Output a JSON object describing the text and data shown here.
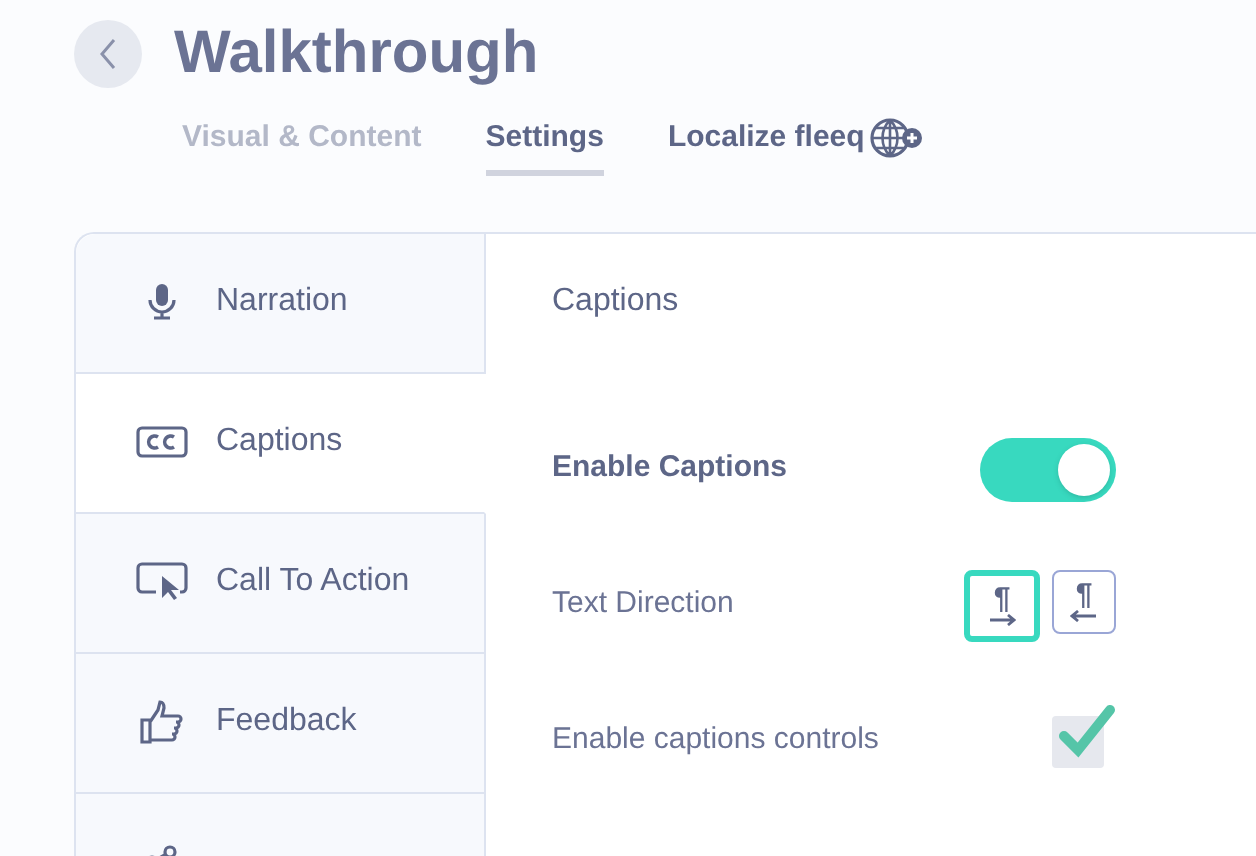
{
  "header": {
    "title": "Walkthrough"
  },
  "tabs": [
    {
      "label": "Visual & Content",
      "selected": false
    },
    {
      "label": "Settings",
      "selected": true
    },
    {
      "label": "Localize fleeq",
      "selected": false
    }
  ],
  "sidebar": {
    "items": [
      {
        "kind": "mic",
        "label": "Narration",
        "selected": false
      },
      {
        "kind": "cc",
        "label": "Captions",
        "selected": true
      },
      {
        "kind": "cta",
        "label": "Call To Action",
        "selected": false
      },
      {
        "kind": "thumb",
        "label": "Feedback",
        "selected": false
      },
      {
        "kind": "share",
        "selected": false
      }
    ]
  },
  "panel": {
    "title": "Captions",
    "rows": [
      {
        "kind": "toggle",
        "label": "Enable Captions",
        "on": true
      },
      {
        "kind": "direction",
        "label": "Text Direction",
        "options": [
          {
            "symbol": "¶",
            "kind": "ltr",
            "selected": true
          },
          {
            "symbol": "¶",
            "kind": "rtl",
            "selected": false
          }
        ]
      },
      {
        "kind": "checkbox",
        "label": "Enable captions controls",
        "checked": true
      }
    ]
  }
}
